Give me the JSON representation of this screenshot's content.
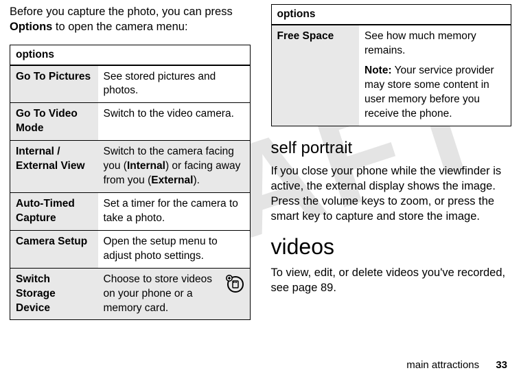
{
  "watermark": "DRAFT",
  "left": {
    "intro_pre": "Before you capture the photo, you can press ",
    "intro_bold": "Options",
    "intro_post": " to open the camera menu:",
    "table_header": "options",
    "rows": [
      {
        "label": "Go To Pictures",
        "desc_pre": "See stored pictures and photos.",
        "desc_mid": "",
        "desc_b1": "",
        "desc_mid2": "",
        "desc_b2": "",
        "desc_post": ""
      },
      {
        "label": "Go To Video Mode",
        "desc_pre": "Switch to the video camera.",
        "desc_mid": "",
        "desc_b1": "",
        "desc_mid2": "",
        "desc_b2": "",
        "desc_post": ""
      },
      {
        "label": "Internal / External View",
        "desc_pre": "Switch to the camera facing you (",
        "desc_b1": "Internal",
        "desc_mid": ") or facing away from you (",
        "desc_b2": "External",
        "desc_post": ")."
      },
      {
        "label": "Auto-Timed Capture",
        "desc_pre": "Set a timer for the camera to take a photo.",
        "desc_mid": "",
        "desc_b1": "",
        "desc_mid2": "",
        "desc_b2": "",
        "desc_post": ""
      },
      {
        "label": "Camera Setup",
        "desc_pre": "Open the setup menu to adjust photo settings.",
        "desc_mid": "",
        "desc_b1": "",
        "desc_mid2": "",
        "desc_b2": "",
        "desc_post": ""
      },
      {
        "label": "Switch Storage Device",
        "desc_pre": "Choose to store videos on your phone or a memory card.",
        "desc_mid": "",
        "desc_b1": "",
        "desc_mid2": "",
        "desc_b2": "",
        "desc_post": ""
      }
    ]
  },
  "right": {
    "table_header": "options",
    "row_label": "Free Space",
    "row_desc1": "See how much memory remains.",
    "row_note_b": "Note:",
    "row_note": " Your service provider may store some content in user memory before you receive the phone.",
    "h_self": "self portrait",
    "p_self": "If you close your phone while the viewfinder is active, the external display shows the image. Press the volume keys to zoom, or press the smart key to capture and store the image.",
    "h_videos": "videos",
    "p_videos": "To view, edit, or delete videos you've recorded, see page 89."
  },
  "footer_text": "main attractions",
  "footer_page": "33"
}
